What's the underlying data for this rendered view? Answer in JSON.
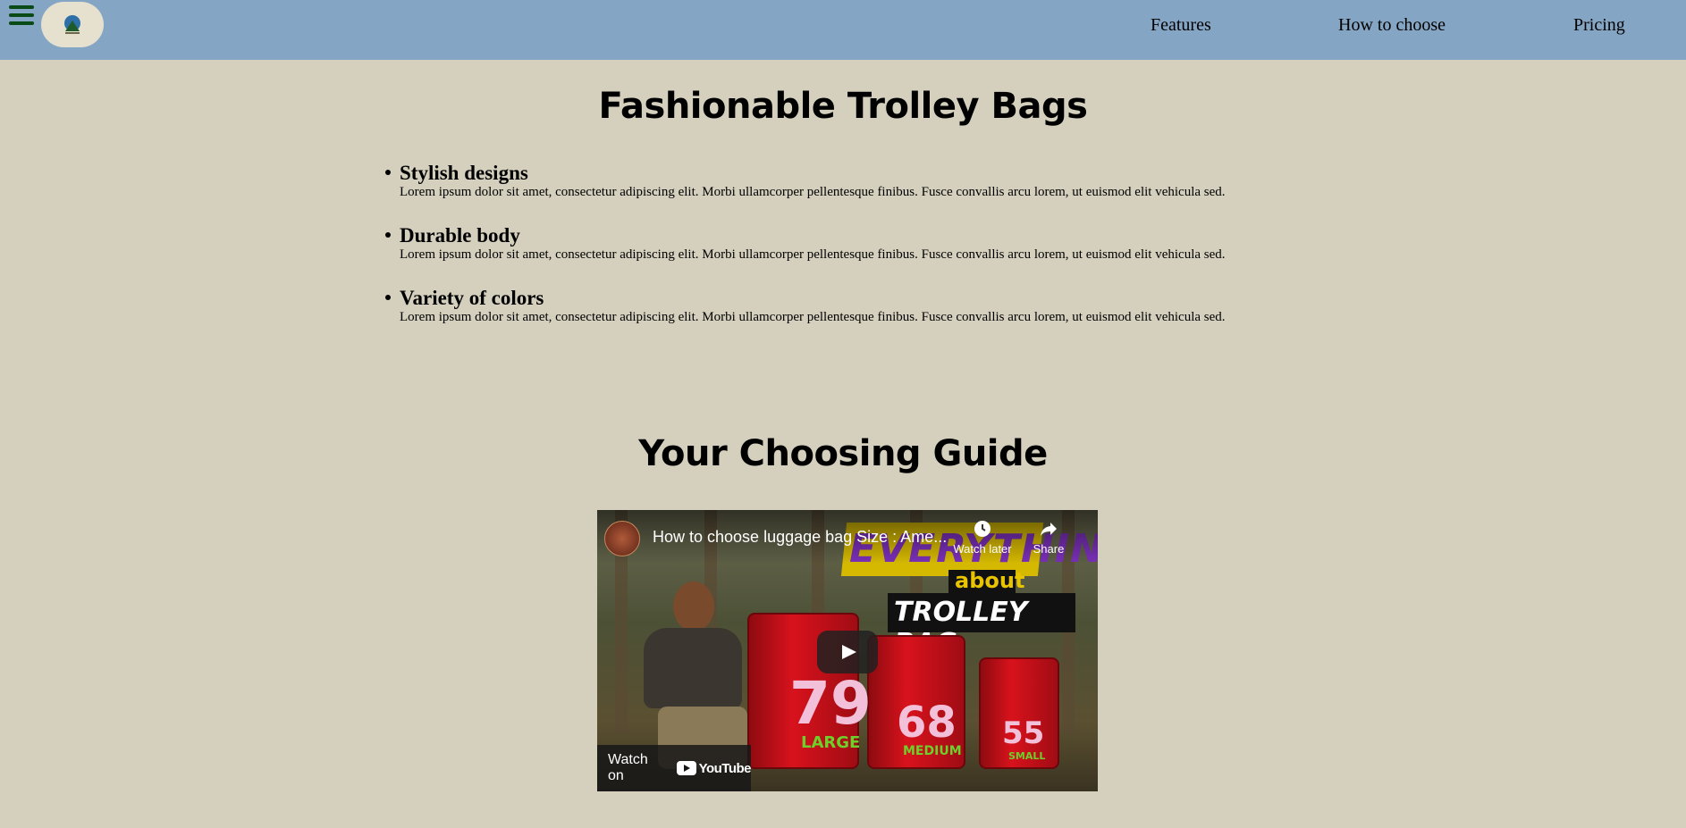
{
  "nav": {
    "menu_icon": "hamburger-menu-icon",
    "logo_icon": "business-logo-icon",
    "links": [
      "Features",
      "How to choose",
      "Pricing"
    ]
  },
  "main": {
    "title": "Fashionable Trolley Bags",
    "features": [
      {
        "title": "Stylish designs",
        "desc": "Lorem ipsum dolor sit amet, consectetur adipiscing elit. Morbi ullamcorper pellentesque finibus. Fusce convallis arcu lorem, ut euismod elit vehicula sed."
      },
      {
        "title": "Durable body",
        "desc": "Lorem ipsum dolor sit amet, consectetur adipiscing elit. Morbi ullamcorper pellentesque finibus. Fusce convallis arcu lorem, ut euismod elit vehicula sed."
      },
      {
        "title": "Variety of colors",
        "desc": "Lorem ipsum dolor sit amet, consectetur adipiscing elit. Morbi ullamcorper pellentesque finibus. Fusce convallis arcu lorem, ut euismod elit vehicula sed."
      }
    ]
  },
  "guide": {
    "title": "Your Choosing Guide",
    "video": {
      "title": "How to choose luggage bag Size : Ame...",
      "watch_later": "Watch later",
      "share": "Share",
      "watch_on": "Watch on",
      "youtube": "YouTube",
      "thumb_banner_1": "EVERYTHING",
      "thumb_banner_2": "about",
      "thumb_banner_3": "TROLLEY BAG",
      "sizes": [
        {
          "number": "79",
          "word": "LARGE"
        },
        {
          "number": "68",
          "word": "MEDIUM"
        },
        {
          "number": "55",
          "word": "SMALL"
        }
      ]
    }
  },
  "colors": {
    "navbar": "#84a5c4",
    "page_bg": "#d5d0be",
    "menu_icon": "#0a4a16"
  }
}
